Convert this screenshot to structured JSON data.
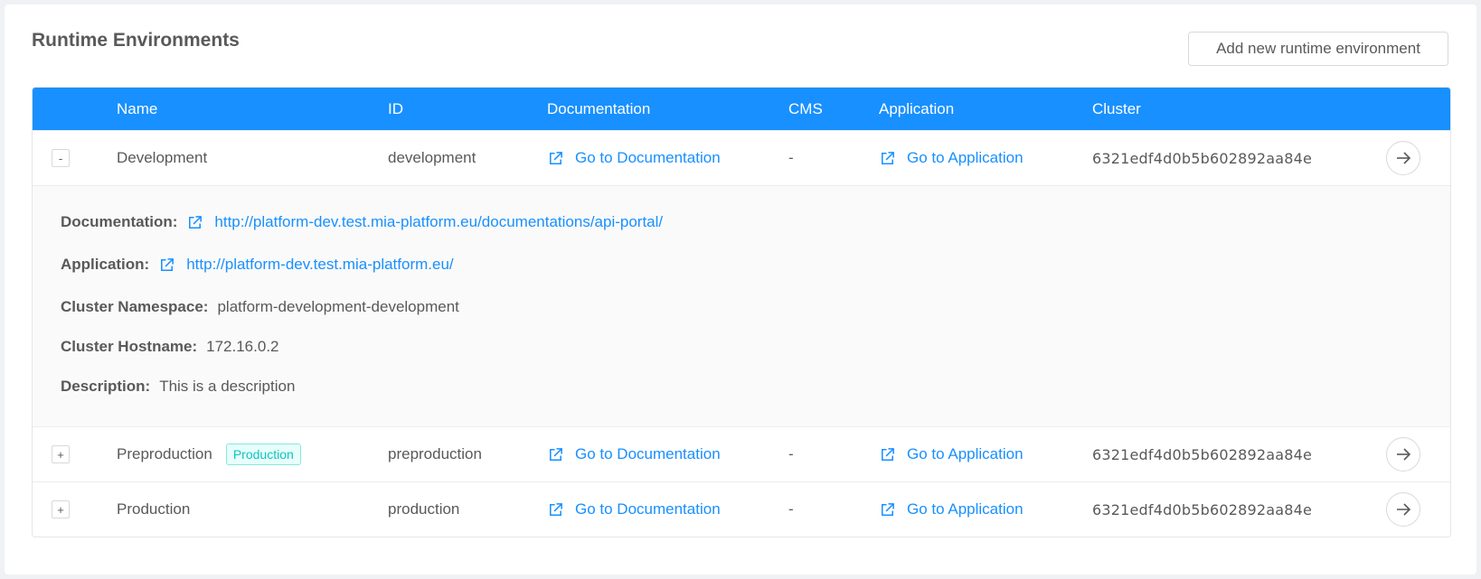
{
  "page": {
    "title": "Runtime Environments",
    "add_button_label": "Add new runtime environment"
  },
  "table": {
    "headers": {
      "name": "Name",
      "id": "ID",
      "documentation": "Documentation",
      "cms": "CMS",
      "application": "Application",
      "cluster": "Cluster"
    },
    "rows": [
      {
        "toggle": "-",
        "name": "Development",
        "tag": "",
        "id": "development",
        "documentation": "Go to Documentation",
        "cms": "-",
        "application": "Go to Application",
        "cluster": "6321edf4d0b5b602892aa84e",
        "expanded": true
      },
      {
        "toggle": "+",
        "name": "Preproduction",
        "tag": "Production",
        "id": "preproduction",
        "documentation": "Go to Documentation",
        "cms": "-",
        "application": "Go to Application",
        "cluster": "6321edf4d0b5b602892aa84e",
        "expanded": false
      },
      {
        "toggle": "+",
        "name": "Production",
        "tag": "",
        "id": "production",
        "documentation": "Go to Documentation",
        "cms": "-",
        "application": "Go to Application",
        "cluster": "6321edf4d0b5b602892aa84e",
        "expanded": false
      }
    ]
  },
  "details": {
    "documentation_label": "Documentation:",
    "documentation_url": "http://platform-dev.test.mia-platform.eu/documentations/api-portal/",
    "application_label": "Application:",
    "application_url": "http://platform-dev.test.mia-platform.eu/",
    "namespace_label": "Cluster Namespace:",
    "namespace_value": "platform-development-development",
    "hostname_label": "Cluster Hostname:",
    "hostname_value": "172.16.0.2",
    "description_label": "Description:",
    "description_value": "This is a description"
  },
  "icons": {
    "external_link": "external-link-icon",
    "goto": "arrow-right-icon"
  },
  "colors": {
    "primary": "#1890ff",
    "tag_text": "#13c2c2",
    "tag_bg": "#e6fffb"
  }
}
